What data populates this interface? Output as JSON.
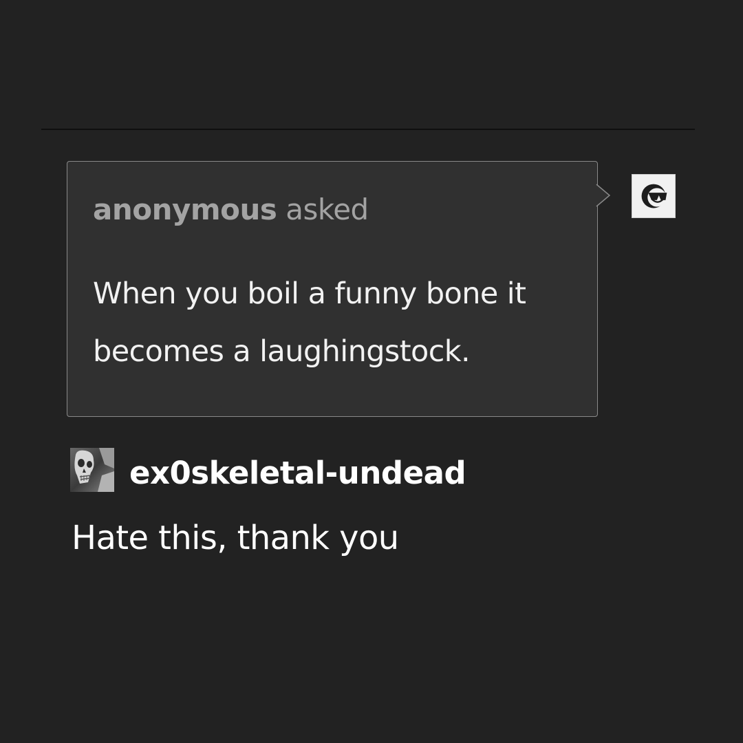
{
  "ask": {
    "asker": "anonymous",
    "verb": "asked",
    "question": "When you boil a funny bone it becomes a laughingstock.",
    "asker_avatar_icon": "sunglasses-smiley-icon"
  },
  "answer": {
    "username": "ex0skeletal-undead",
    "text": "Hate this, thank you",
    "avatar_icon": "skull-avatar-icon"
  },
  "colors": {
    "background": "#222222",
    "bubble_background": "#303030",
    "bubble_border": "#8a8a8a",
    "header_text": "#a3a3a3",
    "body_text": "#ffffff"
  }
}
